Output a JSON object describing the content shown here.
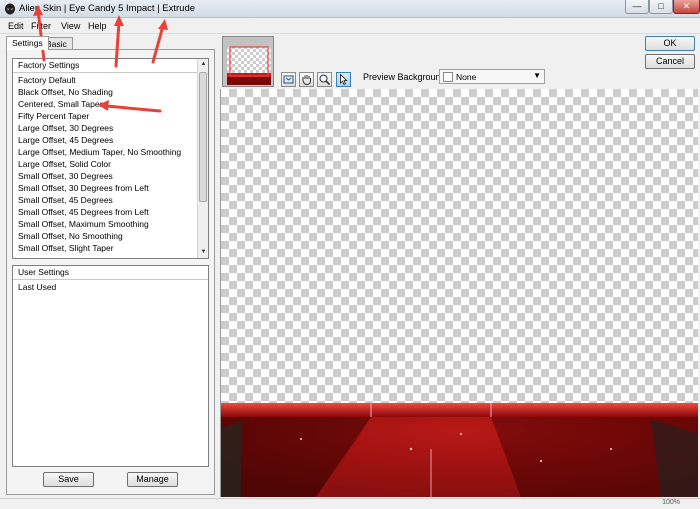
{
  "window": {
    "title": "Alien Skin | Eye Candy 5 Impact | Extrude",
    "minimize_glyph": "—",
    "maximize_glyph": "□",
    "close_glyph": "✕"
  },
  "menu": [
    "Edit",
    "Filter",
    "View",
    "Help"
  ],
  "tabs": [
    "Settings",
    "Basic"
  ],
  "factory_settings": {
    "header": "Factory Settings",
    "items": [
      "Factory Default",
      "Black Offset, No Shading",
      "Centered, Small Taper",
      "Fifty Percent Taper",
      "Large Offset, 30 Degrees",
      "Large Offset, 45 Degrees",
      "Large Offset, Medium Taper, No Smoothing",
      "Large Offset, Solid Color",
      "Small Offset, 30 Degrees",
      "Small Offset, 30 Degrees from Left",
      "Small Offset, 45 Degrees",
      "Small Offset, 45 Degrees from Left",
      "Small Offset, Maximum Smoothing",
      "Small Offset, No Smoothing",
      "Small Offset, Slight Taper"
    ]
  },
  "user_settings": {
    "header": "User Settings",
    "items": [
      "Last Used"
    ]
  },
  "buttons": {
    "save": "Save",
    "manage": "Manage",
    "ok": "OK",
    "cancel": "Cancel"
  },
  "preview": {
    "background_label": "Preview Background:",
    "background_value": "None"
  },
  "icons": {
    "tools": [
      "zoom-fit-icon",
      "hand-pan-icon",
      "magnifier-icon",
      "pointer-arrow-icon"
    ],
    "scroll_up": "▲",
    "scroll_down": "▼"
  },
  "status": {
    "zoom": "100%"
  },
  "colors": {
    "annotation_arrow": "#e8413a",
    "render_red": "#c81818"
  }
}
